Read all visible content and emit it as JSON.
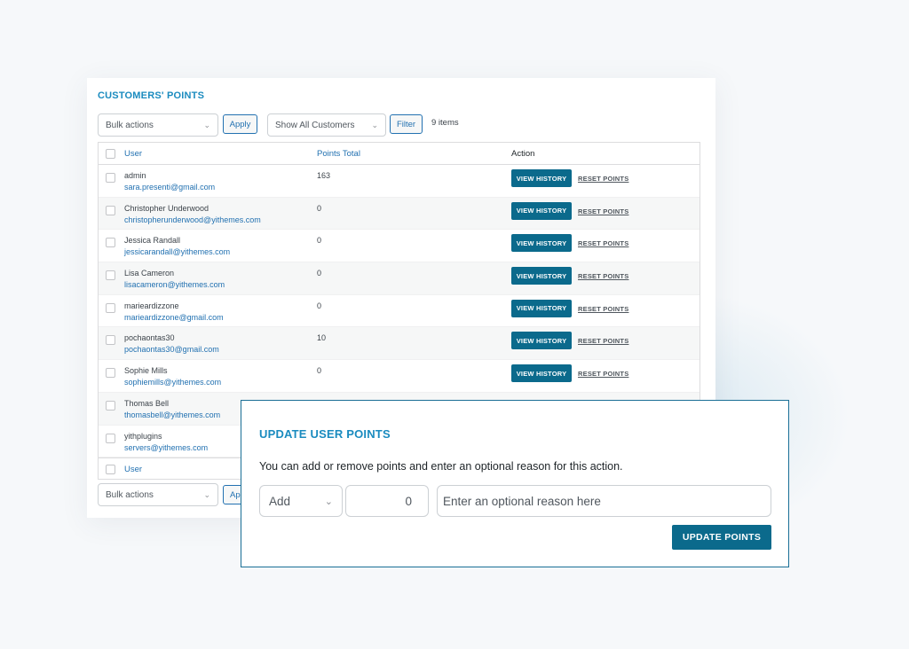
{
  "panel": {
    "title": "CUSTOMERS' POINTS",
    "bulk_actions": "Bulk actions",
    "apply": "Apply",
    "apply_partial": "Ap",
    "customer_filter": "Show All Customers",
    "filter": "Filter",
    "items_count": "9 items"
  },
  "table": {
    "columns": {
      "user": "User",
      "points": "Points Total",
      "action": "Action"
    },
    "view_history": "VIEW HISTORY",
    "reset_points": "RESET POINTS",
    "rows": [
      {
        "name": "admin",
        "email": "sara.presenti@gmail.com",
        "points": "163"
      },
      {
        "name": "Christopher Underwood",
        "email": "christopherunderwood@yithemes.com",
        "points": "0"
      },
      {
        "name": "Jessica Randall",
        "email": "jessicarandall@yithemes.com",
        "points": "0"
      },
      {
        "name": "Lisa Cameron",
        "email": "lisacameron@yithemes.com",
        "points": "0"
      },
      {
        "name": "marieardizzone",
        "email": "marieardizzone@gmail.com",
        "points": "0"
      },
      {
        "name": "pochaontas30",
        "email": "pochaontas30@gmail.com",
        "points": "10"
      },
      {
        "name": "Sophie Mills",
        "email": "sophiemills@yithemes.com",
        "points": "0"
      },
      {
        "name": "Thomas Bell",
        "email": "thomasbell@yithemes.com",
        "points": ""
      },
      {
        "name": "yithplugins",
        "email": "servers@yithemes.com",
        "points": ""
      }
    ]
  },
  "modal": {
    "title": "UPDATE USER POINTS",
    "description": "You can add or remove points and enter an optional reason for this action.",
    "operation": "Add",
    "amount": "0",
    "reason_placeholder": "Enter an optional reason here",
    "submit": "UPDATE POINTS"
  },
  "icons": {
    "select_arrow": "chevron-down-icon",
    "checkbox": "checkbox-icon"
  },
  "colors": {
    "accent": "#1a8bbf",
    "button": "#0b6a8c",
    "link": "#2271b1"
  }
}
